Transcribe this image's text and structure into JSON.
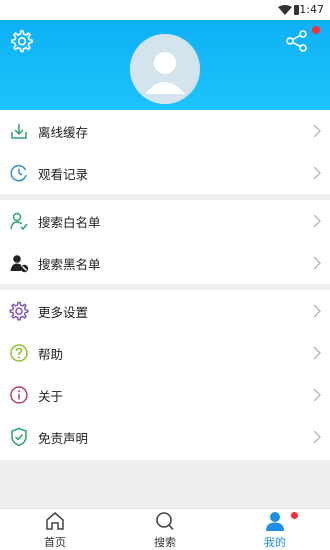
{
  "status_bar": {
    "time": "1:47"
  },
  "menu_groups": [
    [
      {
        "label": "离线缓存",
        "icon": "download-icon"
      },
      {
        "label": "观看记录",
        "icon": "history-icon"
      }
    ],
    [
      {
        "label": "搜索白名单",
        "icon": "whitelist-user-icon"
      },
      {
        "label": "搜索黑名单",
        "icon": "blacklist-user-icon"
      }
    ],
    [
      {
        "label": "更多设置",
        "icon": "gear-icon"
      },
      {
        "label": "帮助",
        "icon": "help-icon"
      },
      {
        "label": "关于",
        "icon": "info-icon"
      },
      {
        "label": "免责声明",
        "icon": "shield-check-icon"
      }
    ]
  ],
  "tabs": [
    {
      "label": "首页",
      "icon": "home-icon"
    },
    {
      "label": "搜索",
      "icon": "search-icon"
    },
    {
      "label": "我的",
      "icon": "user-icon"
    }
  ],
  "colors": {
    "header": "#0eb1f5",
    "accent": "#1f8fe3",
    "badge": "#ff2d3a"
  }
}
